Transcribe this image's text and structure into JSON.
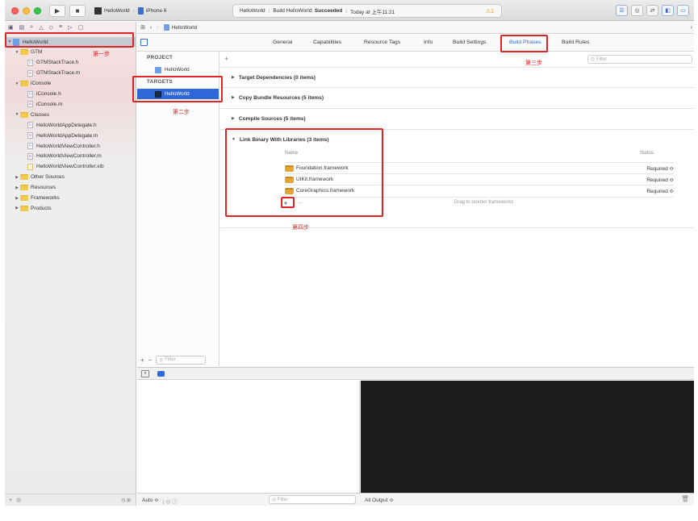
{
  "toolbar": {
    "run_icon": "play-icon",
    "stop_icon": "stop-icon",
    "scheme": "HelloWorld",
    "device": "iPhone 6",
    "activity": {
      "project": "HelloWorld",
      "status_prefix": "Build HelloWorld:",
      "status_result": "Succeeded",
      "time": "Today at 上午11:21"
    },
    "warning_count": "1"
  },
  "navigator": {
    "items": [
      {
        "label": "HelloWorld",
        "kind": "project",
        "level": 0,
        "open": true
      },
      {
        "label": "GTM",
        "kind": "folder",
        "level": 1,
        "open": true
      },
      {
        "label": "GTMStackTrace.h",
        "kind": "h",
        "level": 2
      },
      {
        "label": "GTMStackTrace.m",
        "kind": "m",
        "level": 2
      },
      {
        "label": "iConsole",
        "kind": "folder",
        "level": 1,
        "open": true
      },
      {
        "label": "iConsole.h",
        "kind": "h",
        "level": 2
      },
      {
        "label": "iConsole.m",
        "kind": "m",
        "level": 2
      },
      {
        "label": "Classes",
        "kind": "folder",
        "level": 1,
        "open": true
      },
      {
        "label": "HelloWorldAppDelegate.h",
        "kind": "h",
        "level": 2
      },
      {
        "label": "HelloWorldAppDelegate.m",
        "kind": "m",
        "level": 2
      },
      {
        "label": "HelloWorldViewController.h",
        "kind": "h",
        "level": 2
      },
      {
        "label": "HelloWorldViewController.m",
        "kind": "m",
        "level": 2
      },
      {
        "label": "HelloWorldViewController.xib",
        "kind": "xib",
        "level": 2
      },
      {
        "label": "Other Sources",
        "kind": "folder",
        "level": 1,
        "open": false
      },
      {
        "label": "Resources",
        "kind": "folder",
        "level": 1,
        "open": false
      },
      {
        "label": "Frameworks",
        "kind": "folder",
        "level": 1,
        "open": false
      },
      {
        "label": "Products",
        "kind": "folder",
        "level": 1,
        "open": false
      }
    ]
  },
  "jumpbar": {
    "crumb": "HelloWorld"
  },
  "tabs": [
    {
      "label": "General"
    },
    {
      "label": "Capabilities"
    },
    {
      "label": "Resource Tags"
    },
    {
      "label": "Info"
    },
    {
      "label": "Build Settings"
    },
    {
      "label": "Build Phases",
      "active": true
    },
    {
      "label": "Build Rules"
    }
  ],
  "targets_panel": {
    "project_header": "PROJECT",
    "project_item": "HelloWorld",
    "targets_header": "TARGETS",
    "target_item": "HelloWorld",
    "filter_placeholder": "Filter"
  },
  "phases": {
    "filter_placeholder": "Filter",
    "sections": [
      {
        "title": "Target Dependencies (0 items)"
      },
      {
        "title": "Copy Bundle Resources (5 items)"
      },
      {
        "title": "Compile Sources (5 items)"
      },
      {
        "title": "Link Binary With Libraries (3 items)"
      }
    ],
    "lib_columns": {
      "name": "Name",
      "status": "Status"
    },
    "libraries": [
      {
        "name": "Foundation.framework",
        "status": "Required ≎"
      },
      {
        "name": "UIKit.framework",
        "status": "Required ≎"
      },
      {
        "name": "CoreGraphics.framework",
        "status": "Required ≎"
      }
    ],
    "drag_hint": "Drag to reorder frameworks"
  },
  "debug": {
    "auto_label": "Auto ≎",
    "filter_placeholder": "Filter",
    "output_label": "All Output ≎"
  },
  "annotations": {
    "step1": "第一步",
    "step2": "第二步",
    "step3": "第三步",
    "step4": "第四步",
    "color": "#e02424"
  }
}
